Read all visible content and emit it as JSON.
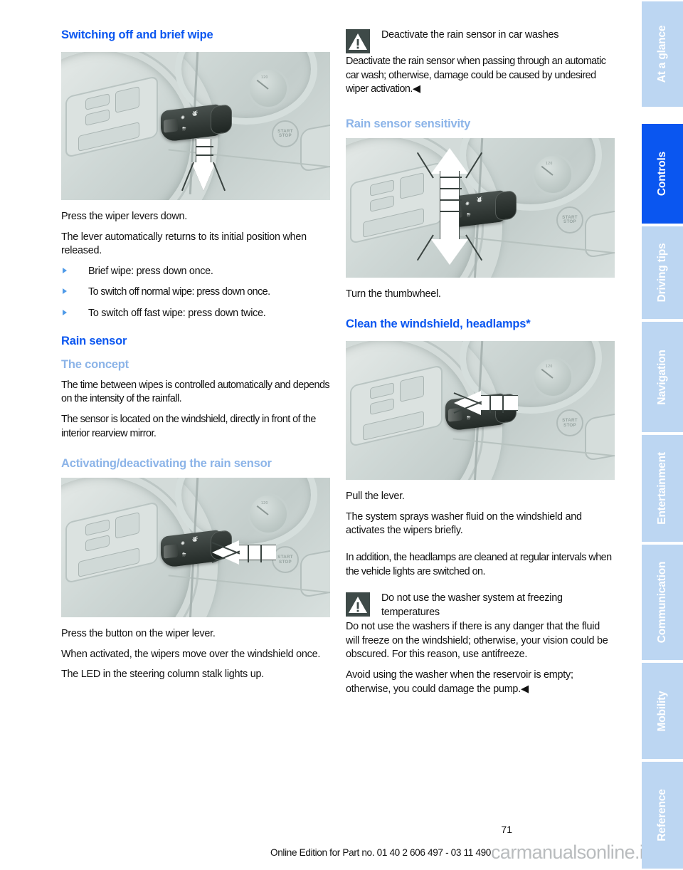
{
  "document": {
    "page_number": "71",
    "footer_text": "Online Edition for Part no. 01 40 2 606 497 - 03 11 490",
    "watermark": "carmanualsonline.info"
  },
  "colors": {
    "heading_main": "#0a56f0",
    "heading_sub": "#8cb4e8",
    "tab_inactive": "#bcd6f2",
    "tab_active": "#0a56f0",
    "warning_icon_bg": "#3e4a48",
    "bullet": "#4f9ae8"
  },
  "left_column": {
    "heading_switching": "Switching off and brief wipe",
    "figure_1_alt": "Steering wheel with wiper stalk and downward arrow",
    "p1": "Press the wiper levers down.",
    "p2": "The lever automatically returns to its initial position when released.",
    "bullets": [
      "Brief wipe: press down once.",
      "To switch off normal wipe: press down once.",
      "To switch off fast wipe: press down twice."
    ],
    "heading_rain_sensor": "Rain sensor",
    "heading_the_concept": "The concept",
    "p3": "The time between wipes is controlled automatically and depends on the intensity of the rainfall.",
    "p4": "The sensor is located on the windshield, directly in front of the interior rearview mirror.",
    "heading_activating": "Activating/deactivating the rain sensor",
    "figure_2_alt": "Steering wheel with wiper stalk and leftward arrow pointing at button",
    "p5": "Press the button on the wiper lever.",
    "p6": "When activated, the wipers move over the windshield once.",
    "p7": "The LED in the steering column stalk lights up."
  },
  "right_column": {
    "warning_1": {
      "icon": "warning-triangle-icon",
      "title": "Deactivate the rain sensor in car washes",
      "body": "Deactivate the rain sensor when passing through an automatic car wash; otherwise, damage could be caused by undesired wiper activation.◀"
    },
    "heading_sensitivity": "Rain sensor sensitivity",
    "figure_3_alt": "Steering wheel with wiper stalk and up/down double arrow on thumbwheel",
    "p1": "Turn the thumbwheel.",
    "heading_clean": "Clean the windshield, headlamps*",
    "figure_4_alt": "Steering wheel with wiper stalk and leftward arrow pulling the lever",
    "p2": "Pull the lever.",
    "p3": "The system sprays washer fluid on the windshield and activates the wipers briefly.",
    "p4": "In addition, the headlamps are cleaned at regular intervals when the vehicle lights are switched on.",
    "warning_2": {
      "icon": "warning-triangle-icon",
      "title": "Do not use the washer system at freezing temperatures",
      "body1": "Do not use the washers if there is any danger that the fluid will freeze on the windshield; otherwise, your vision could be obscured. For this reason, use antifreeze.",
      "body2": "Avoid using the washer when the reservoir is empty; otherwise, you could damage the pump.◀"
    }
  },
  "side_tabs": [
    {
      "label": "At a glance",
      "active": false
    },
    {
      "label": "Controls",
      "active": true
    },
    {
      "label": "Driving tips",
      "active": false
    },
    {
      "label": "Navigation",
      "active": false
    },
    {
      "label": "Entertainment",
      "active": false
    },
    {
      "label": "Communication",
      "active": false
    },
    {
      "label": "Mobility",
      "active": false
    },
    {
      "label": "Reference",
      "active": false
    }
  ]
}
